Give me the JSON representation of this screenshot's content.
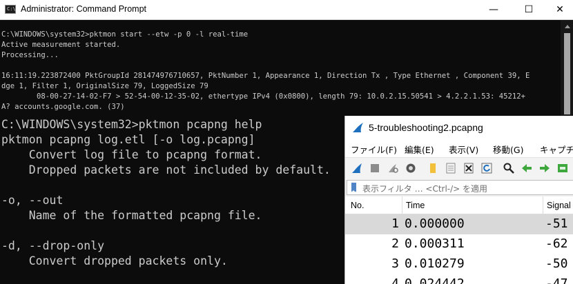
{
  "cmd": {
    "title": "Administrator: Command Prompt",
    "icon": "cmd-icon",
    "icon_text": "C:\\",
    "minimize": "—",
    "maximize": "☐",
    "close": "✕",
    "lines": [
      "C:\\WINDOWS\\system32>pktmon start --etw -p 0 -l real-time",
      "Active measurement started.",
      "Processing...",
      "",
      "16:11:19.223872400 PktGroupId 281474976710657, PktNumber 1, Appearance 1, Direction Tx , Type Ethernet , Component 39, E",
      "dge 1, Filter 1, OriginalSize 79, LoggedSize 79",
      "        08-00-27-14-02-F7 > 52-54-00-12-35-02, ethertype IPv4 (0x0800), length 79: 10.0.2.15.50541 > 4.2.2.1.53: 45212+",
      "A? accounts.google.com. (37)"
    ]
  },
  "help": {
    "lines": [
      "C:\\WINDOWS\\system32>pktmon pcapng help",
      "pktmon pcapng log.etl [-o log.pcapng]",
      "    Convert log file to pcapng format.",
      "    Dropped packets are not included by default.",
      "",
      "-o, --out",
      "    Name of the formatted pcapng file.",
      "",
      "-d, --drop-only",
      "    Convert dropped packets only."
    ]
  },
  "wireshark": {
    "title": "5-troubleshooting2.pcapng",
    "menu": [
      "ファイル(F)",
      "編集(E)",
      "表示(V)",
      "移動(G)",
      "キャプチャ"
    ],
    "filter_placeholder": "表示フィルタ … <Ctrl-/> を適用",
    "columns": [
      "No.",
      "Time",
      "Signal"
    ],
    "rows": [
      {
        "no": "1",
        "time": "0.000000",
        "signal": "-51"
      },
      {
        "no": "2",
        "time": "0.000311",
        "signal": "-62"
      },
      {
        "no": "3",
        "time": "0.010279",
        "signal": "-50"
      },
      {
        "no": "4",
        "time": "0.024442",
        "signal": "-47"
      }
    ],
    "colors": {
      "selected_row": "#d9d9d9",
      "fin": "#1f6fbf"
    }
  }
}
